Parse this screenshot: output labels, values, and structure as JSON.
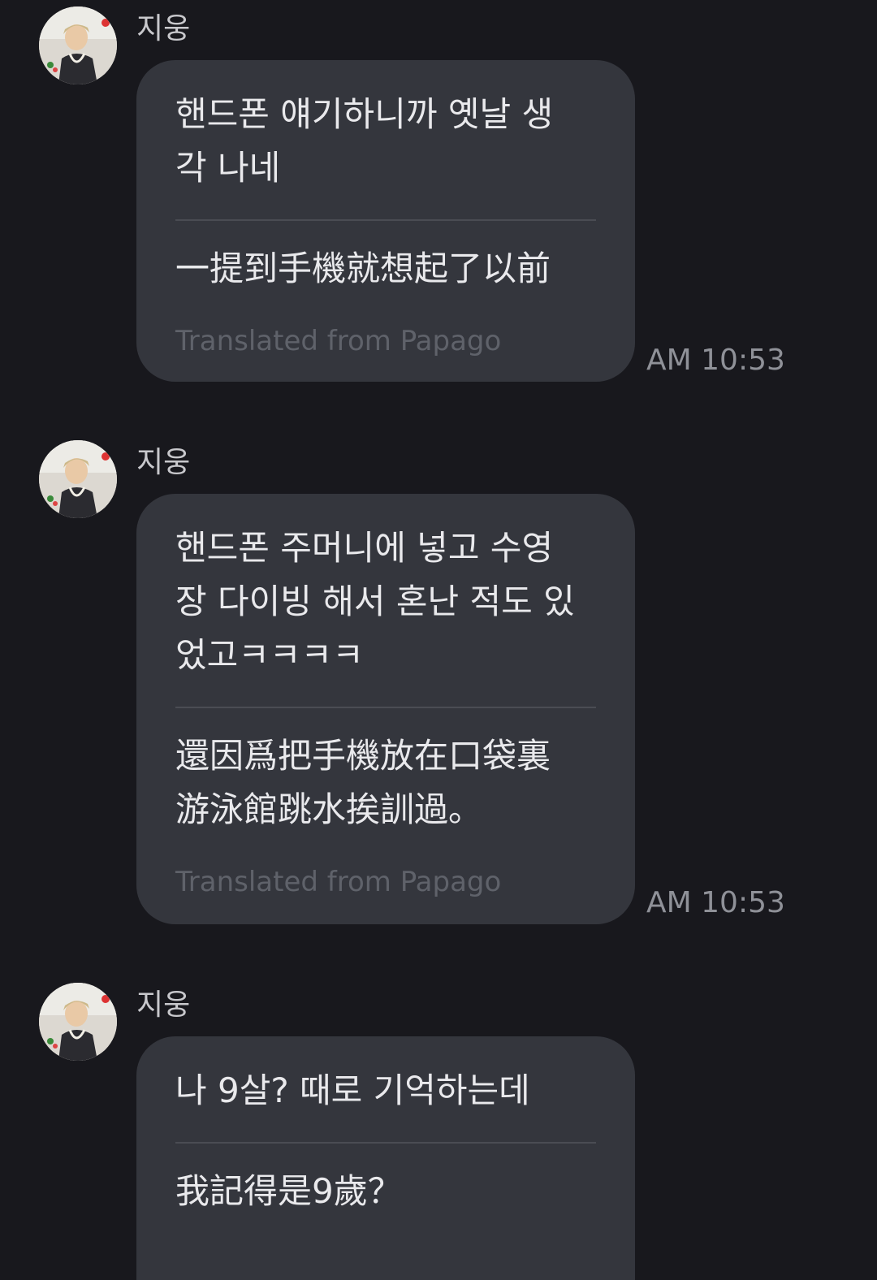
{
  "messages": [
    {
      "sender": "지웅",
      "original": "핸드폰 얘기하니까 옛날 생\n각 나네",
      "translation": "一提到手機就想起了以前",
      "credit": "Translated from Papago",
      "time": "AM 10:53"
    },
    {
      "sender": "지웅",
      "original": "핸드폰 주머니에 넣고 수영\n장 다이빙 해서 혼난 적도 있\n었고ㅋㅋㅋㅋ",
      "translation": "還因爲把手機放在口袋裏\n游泳館跳水挨訓過。",
      "credit": "Translated from Papago",
      "time": "AM 10:53"
    },
    {
      "sender": "지웅",
      "original": "나 9살? 때로 기억하는데",
      "translation": "我記得是9歲？"
    }
  ]
}
